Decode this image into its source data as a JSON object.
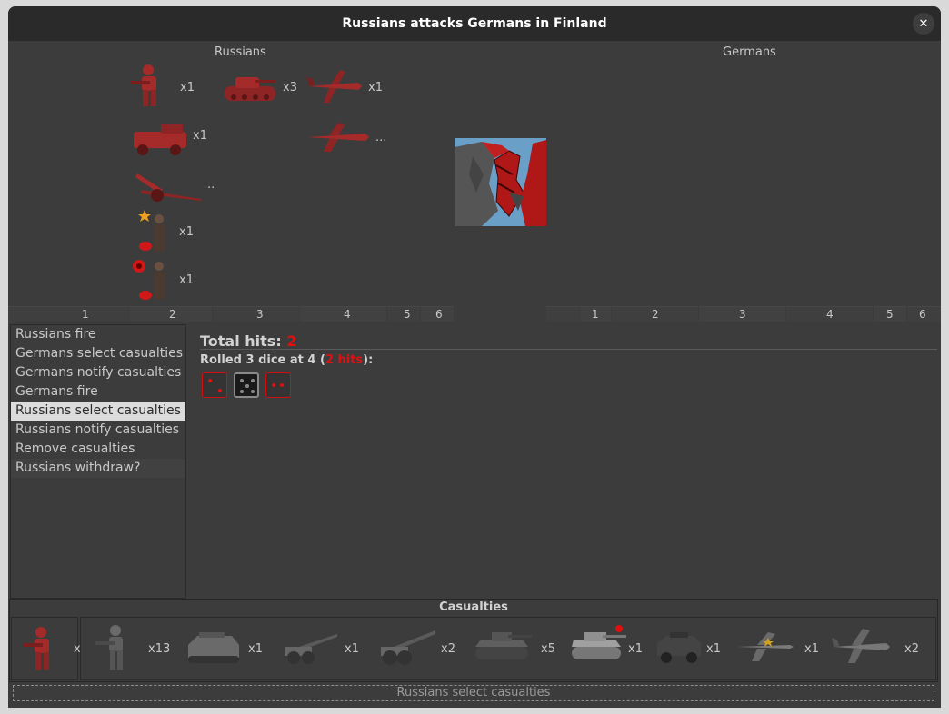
{
  "window": {
    "title": "Russians attacks Germans in Finland",
    "close_glyph": "✕"
  },
  "attacker": {
    "name": "Russians",
    "units": [
      {
        "icon": "infantry-icon",
        "count": "x1"
      },
      {
        "icon": "tank-icon",
        "count": "x3"
      },
      {
        "icon": "fighter-icon",
        "count": "x1"
      },
      {
        "icon": "mech-infantry-icon",
        "count": "x1"
      },
      {
        "icon": "bomber-icon",
        "count": "..."
      },
      {
        "icon": "artillery-icon",
        "count": ".."
      },
      {
        "icon": "general-icon",
        "count": "x1"
      },
      {
        "icon": "officer-icon",
        "count": "x1"
      }
    ],
    "ruler": [
      "1",
      "2",
      "3",
      "4",
      "5",
      "6"
    ]
  },
  "defender": {
    "name": "Germans",
    "ruler": [
      "1",
      "2",
      "3",
      "4",
      "5",
      "6"
    ]
  },
  "territory": {
    "icon": "finland-map-icon"
  },
  "steps": [
    {
      "label": "Russians fire"
    },
    {
      "label": "Germans select casualties"
    },
    {
      "label": "Germans notify casualties"
    },
    {
      "label": "Germans fire"
    },
    {
      "label": "Russians select casualties",
      "active": true
    },
    {
      "label": "Russians notify casualties"
    },
    {
      "label": "Remove casualties"
    },
    {
      "label": "Russians withdraw?"
    }
  ],
  "result": {
    "total_hits_label": "Total hits:",
    "total_hits": "2",
    "rolled_prefix": "Rolled 3 dice at 4 (",
    "rolled_hits": "2 hits",
    "rolled_suffix": "):",
    "dice": [
      {
        "value": 2,
        "hit": true
      },
      {
        "value": 5,
        "hit": false
      },
      {
        "value": 2,
        "hit": true
      }
    ]
  },
  "casualties": {
    "title": "Casualties",
    "selected": {
      "icon": "russian-infantry-icon",
      "count": "x"
    },
    "candidates": [
      {
        "icon": "german-infantry-icon",
        "count": "x13"
      },
      {
        "icon": "halftrack-icon",
        "count": "x1"
      },
      {
        "icon": "artillery-icon",
        "count": "x1"
      },
      {
        "icon": "heavy-artillery-icon",
        "count": "x2"
      },
      {
        "icon": "light-tank-icon",
        "count": "x5"
      },
      {
        "icon": "heavy-tank-icon",
        "count": "x1"
      },
      {
        "icon": "armored-car-icon",
        "count": "x1"
      },
      {
        "icon": "fighter-icon",
        "count": "x1"
      },
      {
        "icon": "bomber-icon",
        "count": "x2"
      }
    ]
  },
  "status": {
    "text": "Russians select casualties"
  },
  "colors": {
    "russian": "#a52a2a",
    "german": "#5f5f5f",
    "hit": "#e01010"
  }
}
